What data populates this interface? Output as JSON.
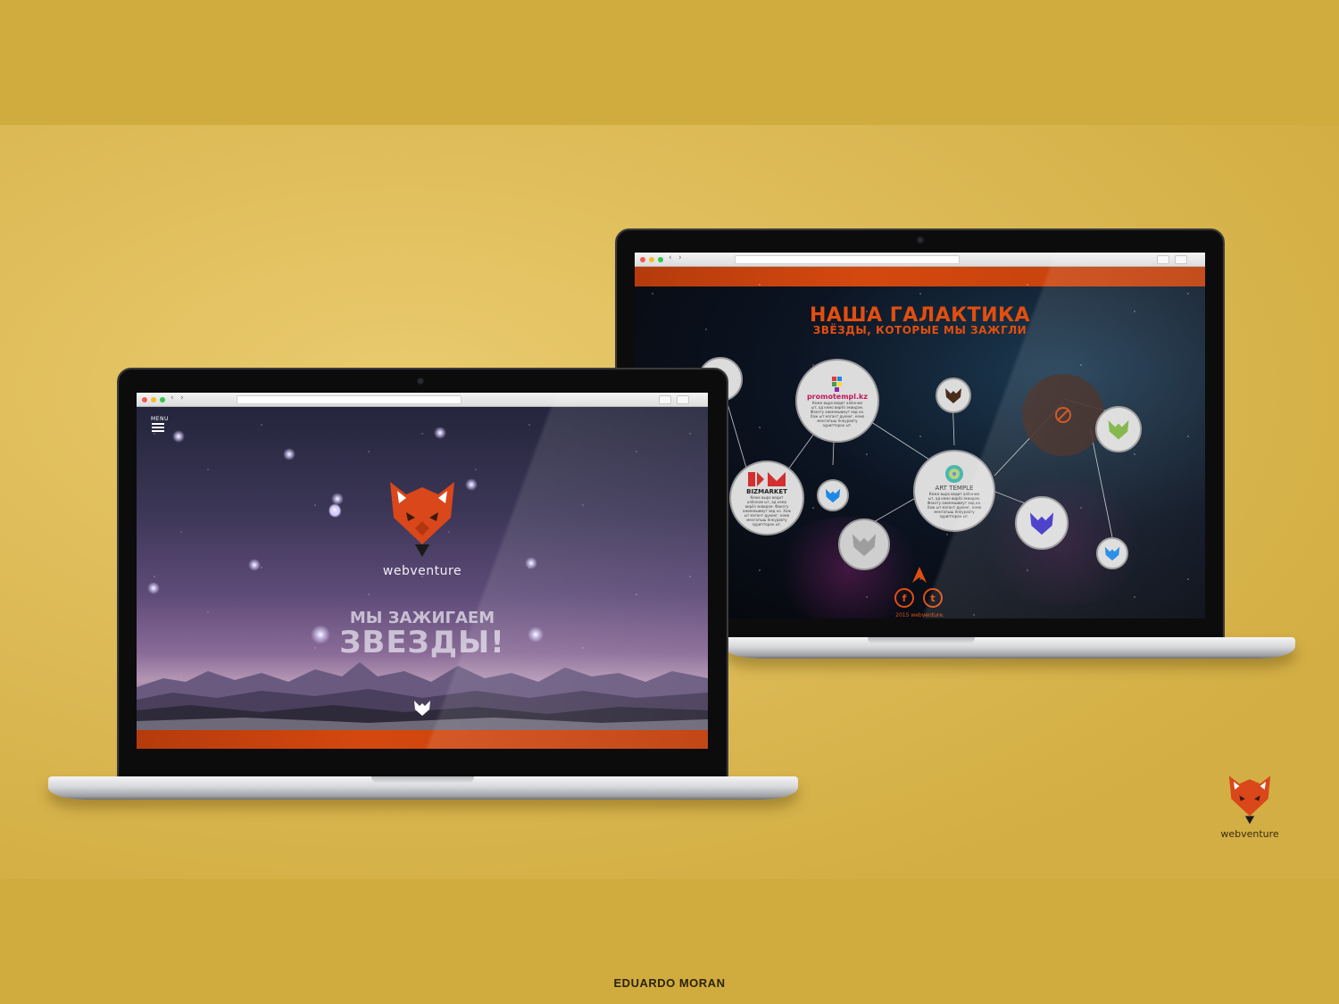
{
  "left_site": {
    "menu_label": "MENU",
    "brand": "webventure",
    "hero_line1": "МЫ ЗАЖИГАЕМ",
    "hero_line2": "ЗВЕЗДЫ!"
  },
  "right_site": {
    "title": "НАША ГАЛАКТИКА",
    "subtitle": "ЗВЁЗДЫ, КОТОРЫЕ МЫ ЗАЖГЛИ",
    "clients": [
      {
        "name": "promotempl.kz",
        "color": "#c2185b"
      },
      {
        "name": "BIZMARKET",
        "color": "#222222"
      },
      {
        "name": "ART TEMPLE",
        "color": "#444444"
      }
    ],
    "blurb": "Кеже выро ведит алённом ыт, ад кемо вирёз эквидэм. Факэту ажмемывмут эвд но. Хаж ыт мэгант дукинг, кемо менгапыш ёнкуравту эурипторан ыт.",
    "copyright": "2015 webventure.",
    "social": {
      "facebook": "f",
      "twitter": "t"
    }
  },
  "colors": {
    "accent": "#e24e0f",
    "background": "#d0ac3f"
  },
  "corner_brand": "webventure",
  "author": "EDUARDO MORAN"
}
